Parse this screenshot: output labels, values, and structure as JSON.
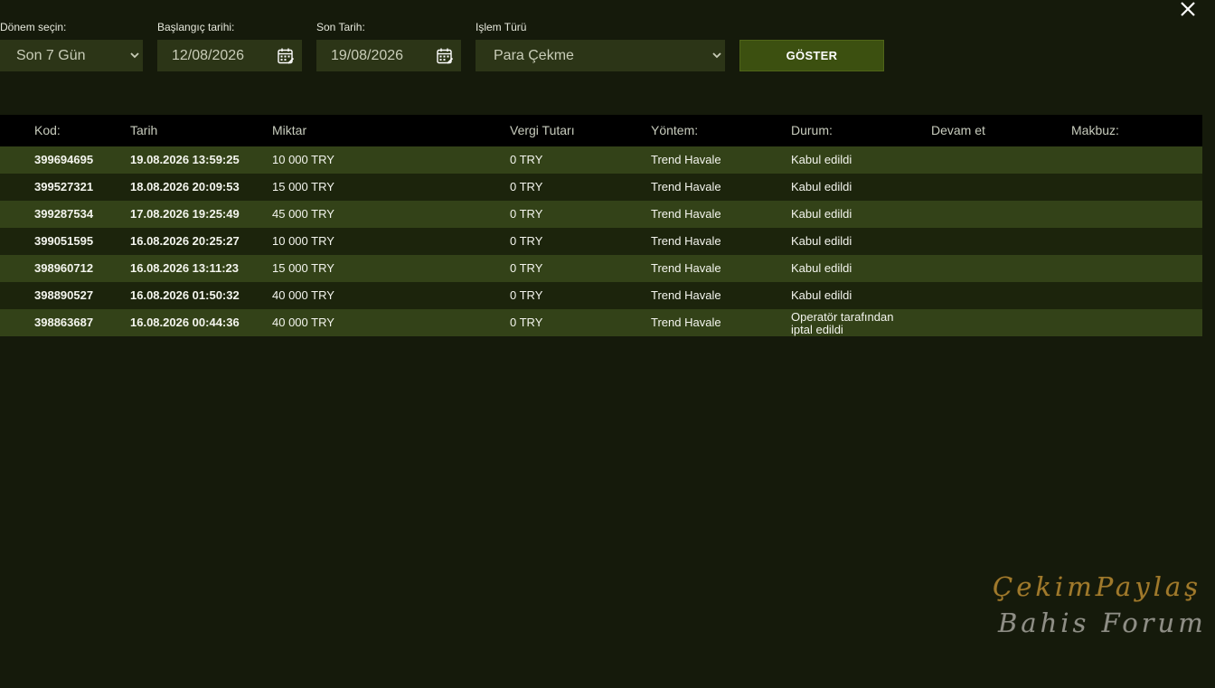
{
  "close": {
    "icon": "close-icon"
  },
  "filters": {
    "period": {
      "label": "Dönem seçin:",
      "value": "Son 7 Gün"
    },
    "start_date": {
      "label": "Başlangıç tarihi:",
      "value": "12/08/2026"
    },
    "end_date": {
      "label": "Son Tarih:",
      "value": "19/08/2026"
    },
    "type": {
      "label": "Işlem Türü",
      "value": "Para Çekme"
    },
    "show_button": "GÖSTER"
  },
  "table": {
    "headers": {
      "kod": "Kod:",
      "tarih": "Tarih",
      "miktar": "Miktar",
      "vergi": "Vergi Tutarı",
      "yontem": "Yöntem:",
      "durum": "Durum:",
      "devam": "Devam et",
      "makbuz": "Makbuz:"
    },
    "rows": [
      {
        "kod": "399694695",
        "tarih": "19.08.2026 13:59:25",
        "miktar": "10 000 TRY",
        "vergi": "0 TRY",
        "yontem": "Trend Havale",
        "durum": "Kabul edildi"
      },
      {
        "kod": "399527321",
        "tarih": "18.08.2026 20:09:53",
        "miktar": "15 000 TRY",
        "vergi": "0 TRY",
        "yontem": "Trend Havale",
        "durum": "Kabul edildi"
      },
      {
        "kod": "399287534",
        "tarih": "17.08.2026 19:25:49",
        "miktar": "45 000 TRY",
        "vergi": "0 TRY",
        "yontem": "Trend Havale",
        "durum": "Kabul edildi"
      },
      {
        "kod": "399051595",
        "tarih": "16.08.2026 20:25:27",
        "miktar": "10 000 TRY",
        "vergi": "0 TRY",
        "yontem": "Trend Havale",
        "durum": "Kabul edildi"
      },
      {
        "kod": "398960712",
        "tarih": "16.08.2026 13:11:23",
        "miktar": "15 000 TRY",
        "vergi": "0 TRY",
        "yontem": "Trend Havale",
        "durum": "Kabul edildi"
      },
      {
        "kod": "398890527",
        "tarih": "16.08.2026 01:50:32",
        "miktar": "40 000 TRY",
        "vergi": "0 TRY",
        "yontem": "Trend Havale",
        "durum": "Kabul edildi"
      },
      {
        "kod": "398863687",
        "tarih": "16.08.2026 00:44:36",
        "miktar": "40 000 TRY",
        "vergi": "0 TRY",
        "yontem": "Trend Havale",
        "durum": "Operatör tarafından iptal edildi"
      }
    ]
  },
  "watermark": {
    "line1": "ÇekimPaylaş",
    "line2": "Bahis Forum"
  },
  "colors": {
    "background": "#151a0b",
    "row_odd": "#334218",
    "row_even": "#1c240c",
    "header_bg": "#000000",
    "button_bg": "#3c5010",
    "control_bg": "#2c3517"
  }
}
